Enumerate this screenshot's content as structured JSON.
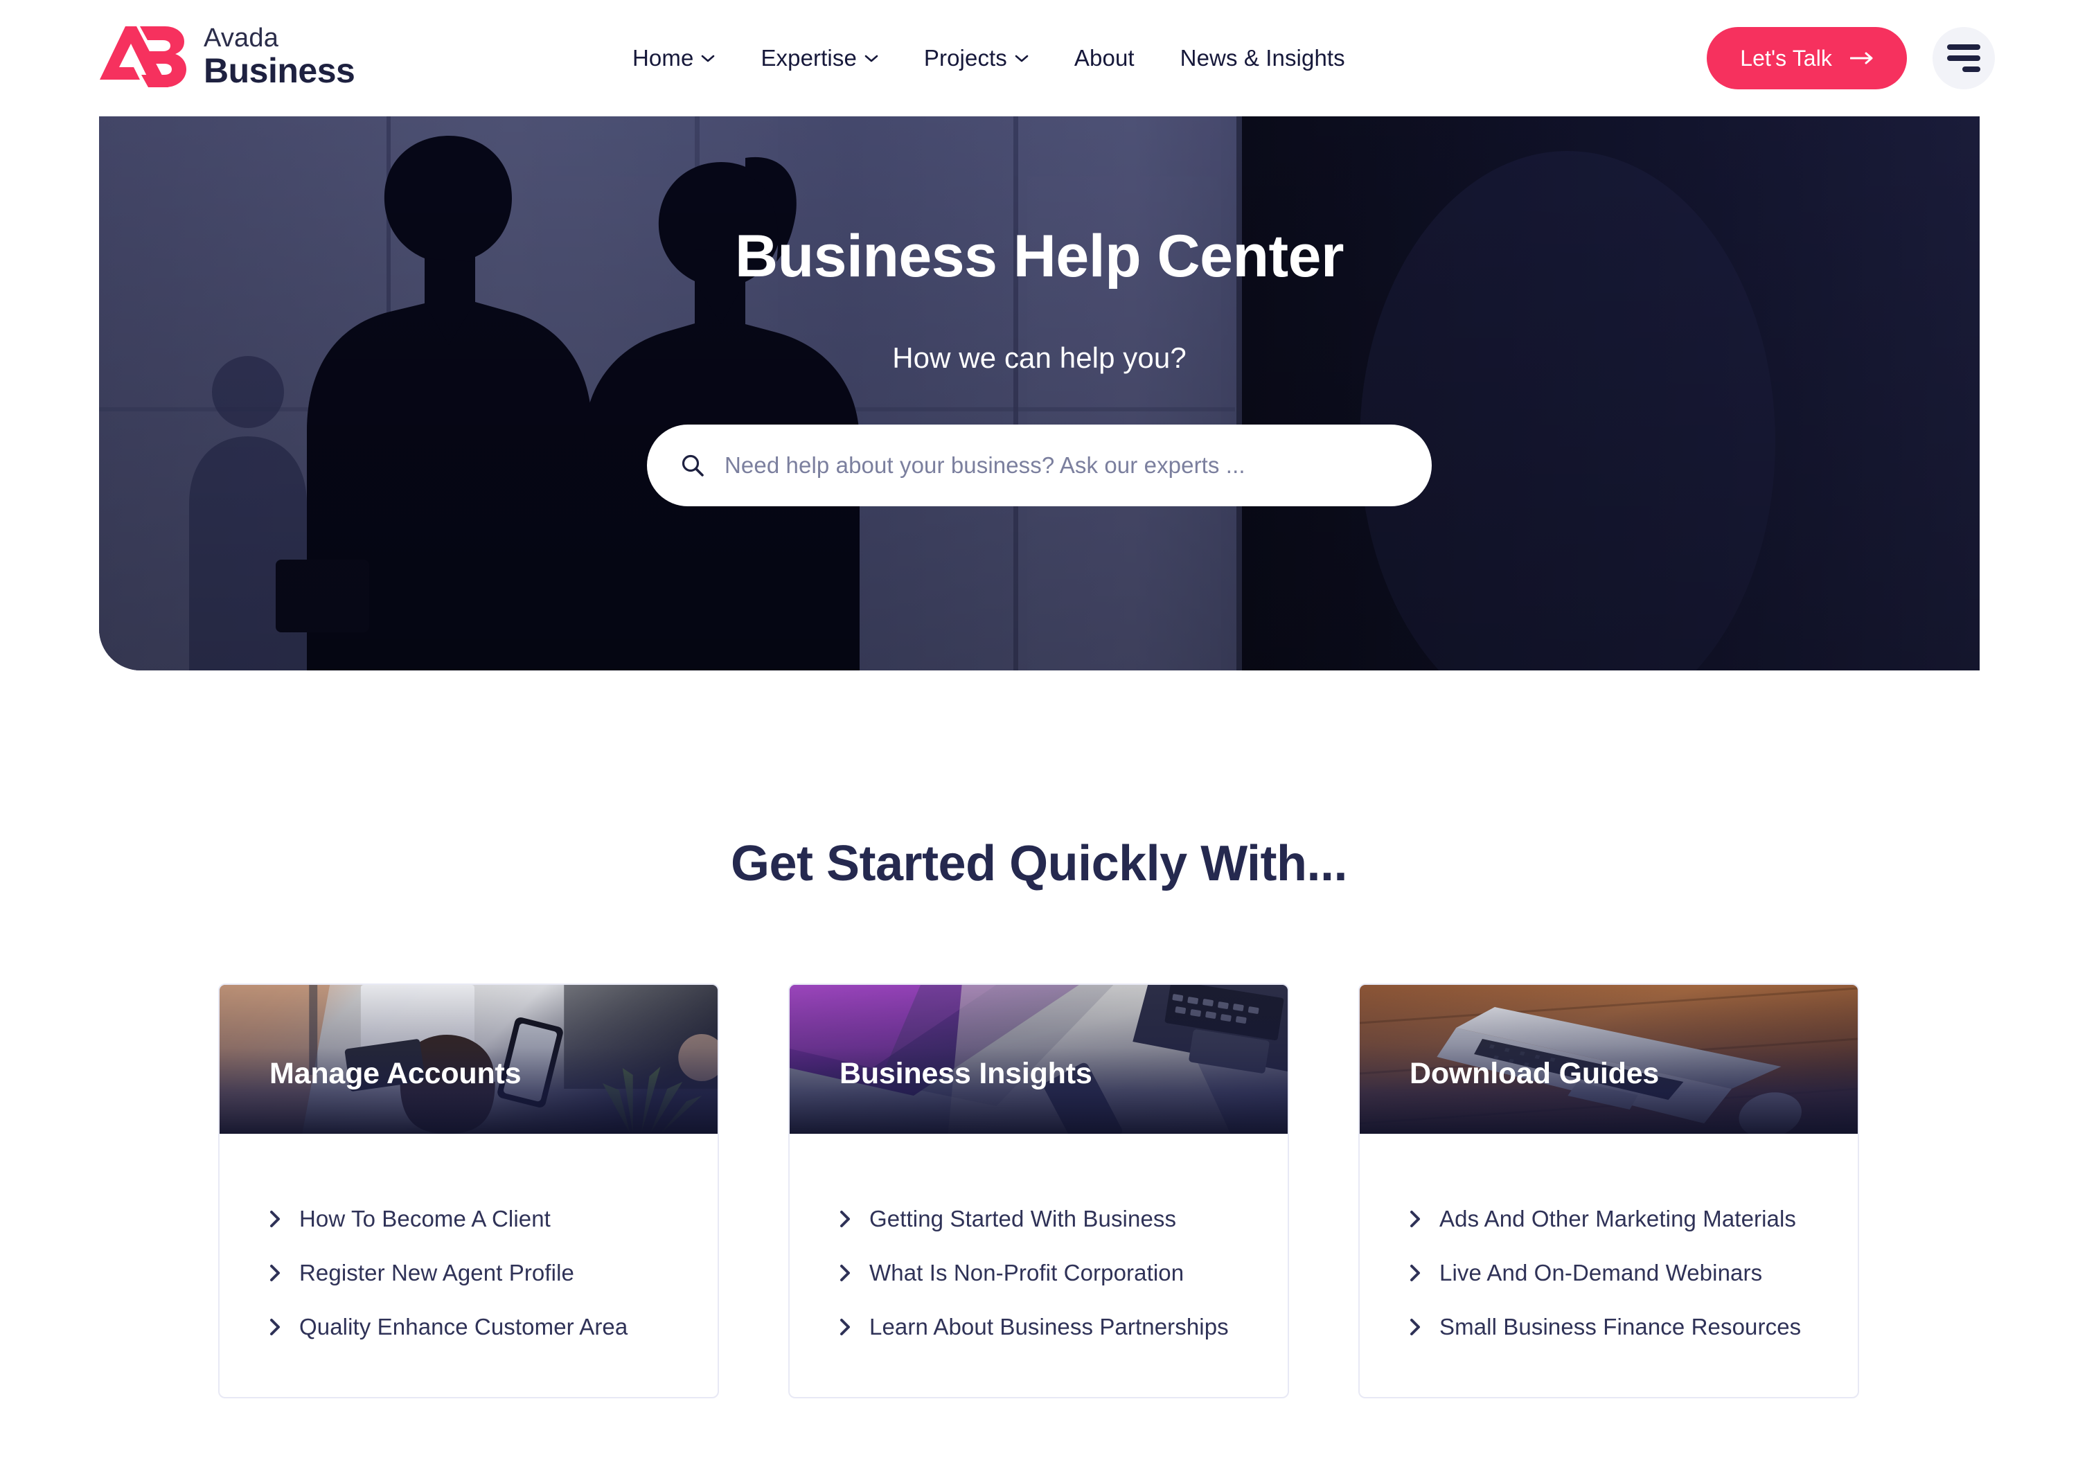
{
  "header": {
    "brand": {
      "logo_icon": "ab-monogram-logo-icon",
      "line1": "Avada",
      "line2": "Business"
    },
    "nav": [
      {
        "label": "Home",
        "has_dropdown": true
      },
      {
        "label": "Expertise",
        "has_dropdown": true
      },
      {
        "label": "Projects",
        "has_dropdown": true
      },
      {
        "label": "About",
        "has_dropdown": false
      },
      {
        "label": "News & Insights",
        "has_dropdown": false
      }
    ],
    "cta": {
      "label": "Let's Talk",
      "icon": "arrow-right-icon",
      "color": "#f6315e"
    },
    "menu_toggle": {
      "icon": "hamburger-menu-icon",
      "background": "#f2f3f8"
    }
  },
  "hero": {
    "title": "Business Help Center",
    "subtitle": "How we can help you?",
    "search": {
      "icon": "search-icon",
      "placeholder": "Need help about your business? Ask our experts ...",
      "value": ""
    }
  },
  "section": {
    "title": "Get Started Quickly With...",
    "cards": [
      {
        "title": "Manage Accounts",
        "image_alt": "woman-at-desk-with-tablet-photo",
        "links": [
          "How To Become A Client",
          "Register New Agent Profile",
          "Quality Enhance Customer Area"
        ]
      },
      {
        "title": "Business Insights",
        "image_alt": "laptop-on-desk-photo",
        "links": [
          "Getting Started With Business",
          "What Is Non-Profit Corporation",
          "Learn About Business Partnerships"
        ]
      },
      {
        "title": "Download Guides",
        "image_alt": "laptop-on-wooden-table-photo",
        "links": [
          "Ads And Other Marketing Materials",
          "Live And On-Demand Webinars",
          "Small Business Finance Resources"
        ]
      }
    ]
  },
  "colors": {
    "accent": "#f6315e",
    "text_dark": "#1e2140",
    "heading": "#25294f",
    "card_border": "#e8e9f5",
    "hero_bg": "#24264a"
  }
}
